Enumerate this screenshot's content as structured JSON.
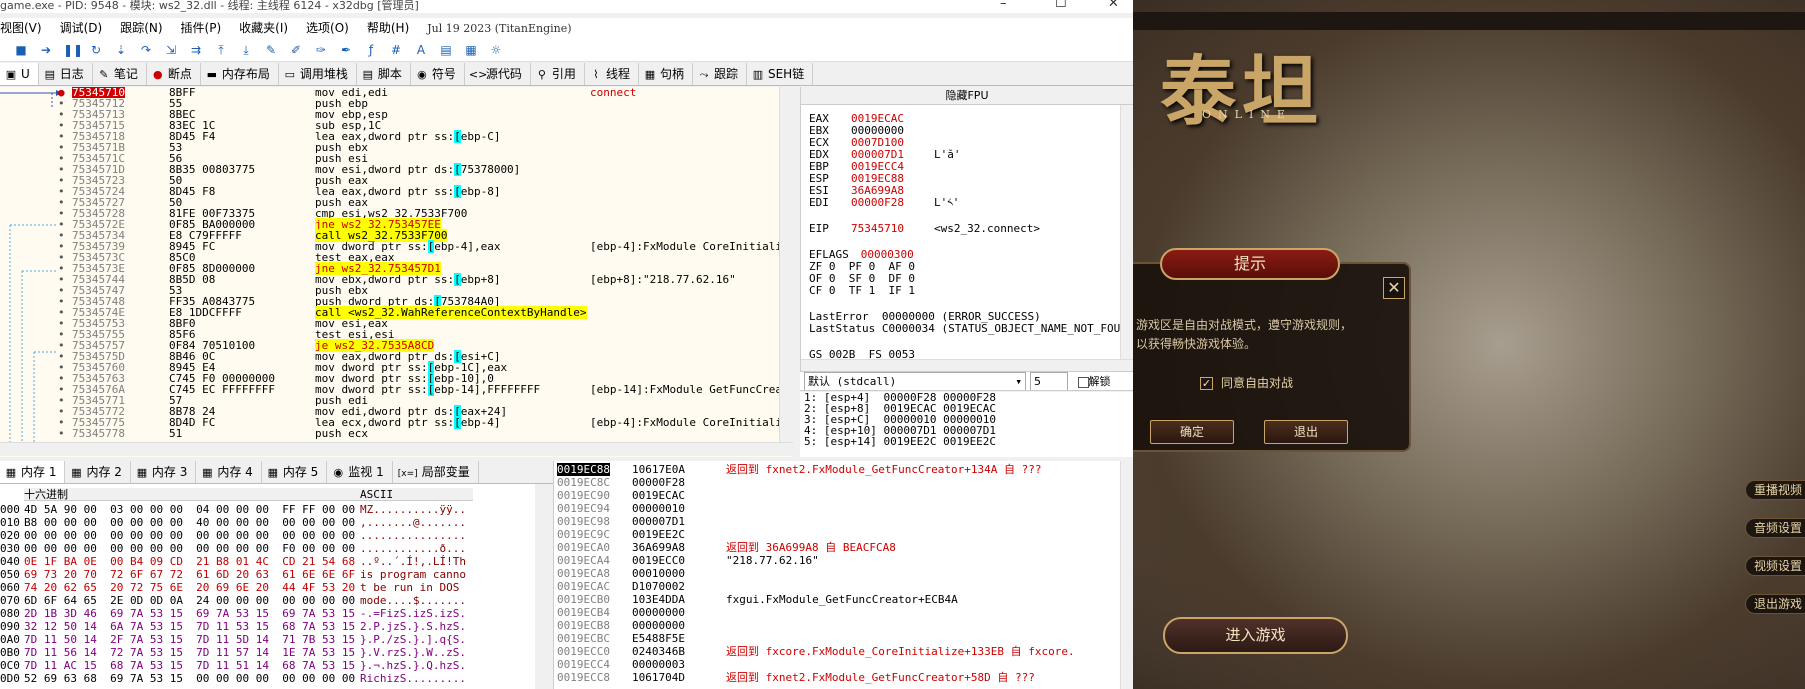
{
  "window": {
    "title": "game.exe - PID: 9548 - 模块: ws2_32.dll - 线程: 主线程 6124 - x32dbg [管理员]"
  },
  "menu": {
    "items": [
      "视图(V)",
      "调试(D)",
      "跟踪(N)",
      "插件(P)",
      "收藏夹(I)",
      "选项(O)",
      "帮助(H)"
    ],
    "version": "Jul 19 2023 (TitanEngine)"
  },
  "toolbar": {
    "icons": [
      "stop-icon",
      "run-icon",
      "pause-icon",
      "restart-icon",
      "step-into-icon",
      "step-over-icon",
      "trace-into-icon",
      "trace-over-icon",
      "execute-till-return-icon",
      "run-to-user-code-icon",
      "patch-icon",
      "comment-icon",
      "label-icon",
      "bookmark-icon",
      "function-icon",
      "hash-icon",
      "font-icon",
      "calculator-icon",
      "memory-icon",
      "about-icon"
    ]
  },
  "tabs": [
    {
      "label": "U",
      "icon": "cpu-icon"
    },
    {
      "label": "日志",
      "icon": "log-icon"
    },
    {
      "label": "笔记",
      "icon": "notes-icon"
    },
    {
      "label": "断点",
      "icon": "breakpoint-icon"
    },
    {
      "label": "内存布局",
      "icon": "memory-map-icon"
    },
    {
      "label": "调用堆栈",
      "icon": "callstack-icon"
    },
    {
      "label": "脚本",
      "icon": "script-icon"
    },
    {
      "label": "符号",
      "icon": "symbol-icon"
    },
    {
      "label": "源代码",
      "icon": "source-icon"
    },
    {
      "label": "引用",
      "icon": "reference-icon"
    },
    {
      "label": "线程",
      "icon": "thread-icon"
    },
    {
      "label": "句柄",
      "icon": "handle-icon"
    },
    {
      "label": "跟踪",
      "icon": "trace-icon"
    },
    {
      "label": "SEH链",
      "icon": "seh-icon"
    }
  ],
  "cpu": {
    "rows": [
      {
        "addr": "75345710",
        "bytes": "8BFF",
        "asm": "mov edi,edi",
        "comment": "connect",
        "sel": true
      },
      {
        "addr": "75345712",
        "bytes": "55",
        "asm": "push ebp",
        "comment": ""
      },
      {
        "addr": "75345713",
        "bytes": "8BEC",
        "asm": "mov ebp,esp",
        "comment": ""
      },
      {
        "addr": "75345715",
        "bytes": "83EC 1C",
        "asm": "sub esp,1C",
        "comment": ""
      },
      {
        "addr": "75345718",
        "bytes": "8D45 F4",
        "asm": "lea eax,dword ptr ss:[ebp-C]",
        "comment": ""
      },
      {
        "addr": "7534571B",
        "bytes": "53",
        "asm": "push ebx",
        "comment": ""
      },
      {
        "addr": "7534571C",
        "bytes": "56",
        "asm": "push esi",
        "comment": ""
      },
      {
        "addr": "7534571D",
        "bytes": "8B35 00803775",
        "asm": "mov esi,dword ptr ds:[75378000]",
        "comment": ""
      },
      {
        "addr": "75345723",
        "bytes": "50",
        "asm": "push eax",
        "comment": ""
      },
      {
        "addr": "75345724",
        "bytes": "8D45 F8",
        "asm": "lea eax,dword ptr ss:[ebp-8]",
        "comment": ""
      },
      {
        "addr": "75345727",
        "bytes": "50",
        "asm": "push eax",
        "comment": ""
      },
      {
        "addr": "75345728",
        "bytes": "81FE 00F73375",
        "asm": "cmp esi,ws2_32.7533F700",
        "comment": ""
      },
      {
        "addr": "7534572E",
        "bytes": "0F85 BA000000",
        "asm": "jne ws2_32.753457EE",
        "comment": "",
        "kind": "jmp"
      },
      {
        "addr": "75345734",
        "bytes": "E8 C79FFFFF",
        "asm": "call ws2_32.7533F700",
        "comment": "",
        "kind": "call"
      },
      {
        "addr": "75345739",
        "bytes": "8945 FC",
        "asm": "mov dword ptr ss:[ebp-4],eax",
        "comment": "[ebp-4]:FxModule_CoreInitialize"
      },
      {
        "addr": "7534573C",
        "bytes": "85C0",
        "asm": "test eax,eax",
        "comment": ""
      },
      {
        "addr": "7534573E",
        "bytes": "0F85 8D000000",
        "asm": "jne ws2_32.753457D1",
        "comment": "",
        "kind": "jmp"
      },
      {
        "addr": "75345744",
        "bytes": "8B5D 08",
        "asm": "mov ebx,dword ptr ss:[ebp+8]",
        "comment": "[ebp+8]:\"218.77.62.16\""
      },
      {
        "addr": "75345747",
        "bytes": "53",
        "asm": "push ebx",
        "comment": ""
      },
      {
        "addr": "75345748",
        "bytes": "FF35 A0843775",
        "asm": "push dword ptr ds:[753784A0]",
        "comment": ""
      },
      {
        "addr": "7534574E",
        "bytes": "E8 1DDCFFFF",
        "asm": "call <ws2_32.WahReferenceContextByHandle>",
        "comment": "",
        "kind": "call"
      },
      {
        "addr": "75345753",
        "bytes": "8BF0",
        "asm": "mov esi,eax",
        "comment": ""
      },
      {
        "addr": "75345755",
        "bytes": "85F6",
        "asm": "test esi,esi",
        "comment": ""
      },
      {
        "addr": "75345757",
        "bytes": "0F84 70510100",
        "asm": "je ws2_32.7535A8CD",
        "comment": "",
        "kind": "jmp"
      },
      {
        "addr": "7534575D",
        "bytes": "8B46 0C",
        "asm": "mov eax,dword ptr ds:[esi+C]",
        "comment": ""
      },
      {
        "addr": "75345760",
        "bytes": "8945 E4",
        "asm": "mov dword ptr ss:[ebp-1C],eax",
        "comment": ""
      },
      {
        "addr": "75345763",
        "bytes": "C745 F0 00000000",
        "asm": "mov dword ptr ss:[ebp-10],0",
        "comment": ""
      },
      {
        "addr": "7534576A",
        "bytes": "C745 EC FFFFFFFF",
        "asm": "mov dword ptr ss:[ebp-14],FFFFFFFF",
        "comment": "[ebp-14]:FxModule_GetFuncCreator"
      },
      {
        "addr": "75345771",
        "bytes": "57",
        "asm": "push edi",
        "comment": ""
      },
      {
        "addr": "75345772",
        "bytes": "8B78 24",
        "asm": "mov edi,dword ptr ds:[eax+24]",
        "comment": ""
      },
      {
        "addr": "75345775",
        "bytes": "8D4D FC",
        "asm": "lea ecx,dword ptr ss:[ebp-4]",
        "comment": "[ebp-4]:FxModule_CoreInitialize"
      },
      {
        "addr": "75345778",
        "bytes": "51",
        "asm": "push ecx",
        "comment": ""
      }
    ]
  },
  "registers": {
    "header": "隐藏FPU",
    "items": [
      {
        "name": "EAX",
        "value": "0019ECAC",
        "changed": true,
        "extra": ""
      },
      {
        "name": "EBX",
        "value": "00000000",
        "changed": false,
        "extra": ""
      },
      {
        "name": "ECX",
        "value": "0007D100",
        "changed": true,
        "extra": ""
      },
      {
        "name": "EDX",
        "value": "000007D1",
        "changed": true,
        "extra": "L'ӑ'"
      },
      {
        "name": "EBP",
        "value": "0019ECC4",
        "changed": true,
        "extra": ""
      },
      {
        "name": "ESP",
        "value": "0019EC88",
        "changed": true,
        "extra": ""
      },
      {
        "name": "ESI",
        "value": "36A699A8",
        "changed": true,
        "extra": ""
      },
      {
        "name": "EDI",
        "value": "00000F28",
        "changed": true,
        "extra": "L'༨'"
      }
    ],
    "eip_name": "EIP",
    "eip_value": "75345710",
    "eip_extra": "<ws2_32.connect>",
    "eflags_name": "EFLAGS",
    "eflags_value": "00000300",
    "flags": [
      "ZF 0  PF 0  AF 0",
      "OF 0  SF 0  DF 0",
      "CF 0  TF 1  IF 1"
    ],
    "lasterror": "LastError  00000000 (ERROR_SUCCESS)",
    "laststatus": "LastStatus C0000034 (STATUS_OBJECT_NAME_NOT_FOUND)",
    "segs": "GS 002B  FS 0053"
  },
  "callconv": {
    "label": "默认 (stdcall)",
    "count": "5",
    "unlock_label": "解锁"
  },
  "stackargs": [
    "1: [esp+4]  00000F28 00000F28",
    "2: [esp+8]  0019ECAC 0019ECAC",
    "3: [esp+C]  00000010 00000010",
    "4: [esp+10] 000007D1 000007D1",
    "5: [esp+14] 0019EE2C 0019EE2C"
  ],
  "bottom_tabs": [
    {
      "label": "内存 1",
      "icon": "memory-icon"
    },
    {
      "label": "内存 2",
      "icon": "memory-icon"
    },
    {
      "label": "内存 3",
      "icon": "memory-icon"
    },
    {
      "label": "内存 4",
      "icon": "memory-icon"
    },
    {
      "label": "内存 5",
      "icon": "memory-icon"
    },
    {
      "label": "监视 1",
      "icon": "watch-icon"
    },
    {
      "label": "局部变量",
      "icon": "locals-icon"
    }
  ],
  "dump": {
    "hex_header": "十六进制",
    "ascii_header": "ASCII",
    "rows": [
      {
        "off": "000",
        "hex": "4D 5A 90 00  03 00 00 00  04 00 00 00  FF FF 00 00",
        "ascii": "MZ..........ÿÿ.."
      },
      {
        "off": "010",
        "hex": "B8 00 00 00  00 00 00 00  40 00 00 00  00 00 00 00",
        "ascii": ",.......@......."
      },
      {
        "off": "020",
        "hex": "00 00 00 00  00 00 00 00  00 00 00 00  00 00 00 00",
        "ascii": "................"
      },
      {
        "off": "030",
        "hex": "00 00 00 00  00 00 00 00  00 00 00 00  F0 00 00 00",
        "ascii": "............ð..."
      },
      {
        "off": "040",
        "hex": "0E 1F BA 0E  00 B4 09 CD  21 B8 01 4C  CD 21 54 68",
        "ascii": "..º..´.Í!,.LÍ!Th"
      },
      {
        "off": "050",
        "hex": "69 73 20 70  72 6F 67 72  61 6D 20 63  61 6E 6E 6F",
        "ascii": "is program canno"
      },
      {
        "off": "060",
        "hex": "74 20 62 65  20 72 75 6E  20 69 6E 20  44 4F 53 20",
        "ascii": "t be run in DOS "
      },
      {
        "off": "070",
        "hex": "6D 6F 64 65  2E 0D 0D 0A  24 00 00 00  00 00 00 00",
        "ascii": "mode....$......."
      },
      {
        "off": "080",
        "hex": "2D 1B 3D 46  69 7A 53 15  69 7A 53 15  69 7A 53 15",
        "ascii": "-.=FizS.izS.izS."
      },
      {
        "off": "090",
        "hex": "32 12 50 14  6A 7A 53 15  7D 11 53 15  68 7A 53 15",
        "ascii": "2.P.jzS.}.S.hzS."
      },
      {
        "off": "0A0",
        "hex": "7D 11 50 14  2F 7A 53 15  7D 11 5D 14  71 7B 53 15",
        "ascii": "}.P./zS.}.].q{S."
      },
      {
        "off": "0B0",
        "hex": "7D 11 56 14  72 7A 53 15  7D 11 57 14  1E 7A 53 15",
        "ascii": "}.V.rzS.}.W..zS."
      },
      {
        "off": "0C0",
        "hex": "7D 11 AC 15  68 7A 53 15  7D 11 51 14  68 7A 53 15",
        "ascii": "}.¬.hzS.}.Q.hzS."
      },
      {
        "off": "0D0",
        "hex": "52 69 63 68  69 7A 53 15  00 00 00 00  00 00 00 00",
        "ascii": "RichizS........."
      }
    ]
  },
  "stack": {
    "rows": [
      {
        "addr": "0019EC88",
        "val": "10617E0A",
        "comment": "返回到 fxnet2.FxModule_GetFuncCreator+134A 自 ???",
        "red": true,
        "top": true
      },
      {
        "addr": "0019EC8C",
        "val": "00000F28",
        "comment": ""
      },
      {
        "addr": "0019EC90",
        "val": "0019ECAC",
        "comment": ""
      },
      {
        "addr": "0019EC94",
        "val": "00000010",
        "comment": ""
      },
      {
        "addr": "0019EC98",
        "val": "000007D1",
        "comment": ""
      },
      {
        "addr": "0019EC9C",
        "val": "0019EE2C",
        "comment": ""
      },
      {
        "addr": "0019ECA0",
        "val": "36A699A8",
        "comment": "返回到 36A699A8 自 BEACFCA8",
        "red": true
      },
      {
        "addr": "0019ECA4",
        "val": "0019ECC0",
        "comment": "\"218.77.62.16\""
      },
      {
        "addr": "0019ECA8",
        "val": "00010000",
        "comment": ""
      },
      {
        "addr": "0019ECAC",
        "val": "D1070002",
        "comment": ""
      },
      {
        "addr": "0019ECB0",
        "val": "103E4DDA",
        "comment": "fxgui.FxModule_GetFuncCreator+ECB4A"
      },
      {
        "addr": "0019ECB4",
        "val": "00000000",
        "comment": ""
      },
      {
        "addr": "0019ECB8",
        "val": "00000000",
        "comment": ""
      },
      {
        "addr": "0019ECBC",
        "val": "E5488F5E",
        "comment": ""
      },
      {
        "addr": "0019ECC0",
        "val": "0240346B",
        "comment": "返回到 fxcore.FxModule_CoreInitialize+133EB 自 fxcore.",
        "red": true
      },
      {
        "addr": "0019ECC4",
        "val": "00000003",
        "comment": ""
      },
      {
        "addr": "0019ECC8",
        "val": "1061704D",
        "comment": "返回到 fxnet2.FxModule_GetFuncCreator+58D 自 ???",
        "red": true
      }
    ]
  },
  "game": {
    "logo": "泰坦",
    "logo_sub": "ONLINE",
    "dialog_title": "提示",
    "dialog_msg1": "游戏区是自由对战模式，遵守游戏规则，",
    "dialog_msg2": "以获得畅快游戏体验。",
    "agree_label": "同意自由对战",
    "agree_checked": "✓",
    "ok_label": "确定",
    "cancel_label": "退出",
    "enter_label": "进入游戏",
    "side_buttons": [
      "重播视频",
      "音频设置",
      "视频设置",
      "退出游戏"
    ]
  },
  "colors": {
    "changed_reg": "#cc0000",
    "selection": "#cc0000",
    "highlight_yellow": "#ffff00",
    "mem_cyan": "#00ffff",
    "game_gold": "#c9a567"
  }
}
